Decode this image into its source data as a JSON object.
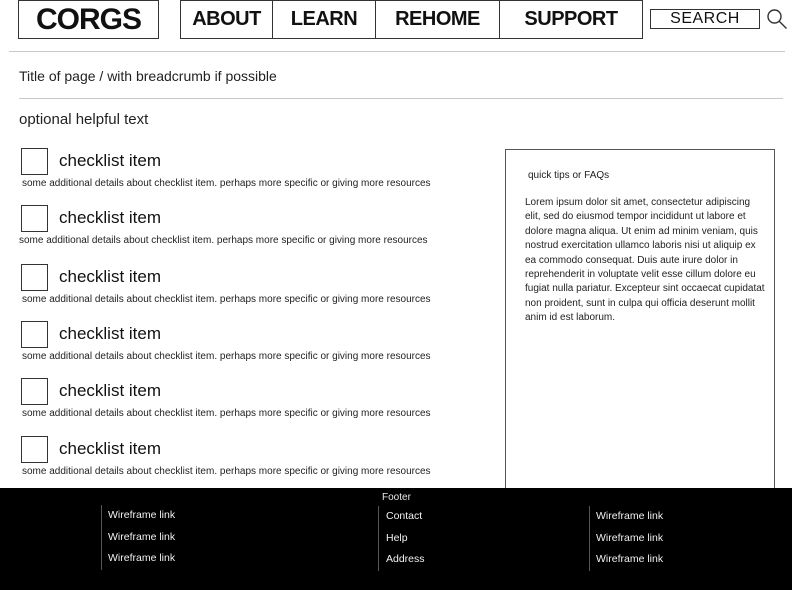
{
  "header": {
    "logo": "CORGS",
    "nav": [
      "ABOUT",
      "LEARN",
      "REHOME",
      "SUPPORT"
    ],
    "search_label": "SEARCH"
  },
  "page": {
    "title": "Title of page  / with breadcrumb if possible",
    "helper_text": "optional helpful text"
  },
  "checklist": [
    {
      "title": "checklist item",
      "detail": "some additional details about checklist item. perhaps more specific or giving more resources"
    },
    {
      "title": "checklist item",
      "detail": "some additional details about checklist item. perhaps more specific or giving more resources"
    },
    {
      "title": "checklist item",
      "detail": "some additional details about checklist item. perhaps more specific or giving more resources"
    },
    {
      "title": "checklist item",
      "detail": "some additional details about checklist item. perhaps more specific or giving more resources"
    },
    {
      "title": "checklist item",
      "detail": "some additional details about checklist item. perhaps more specific or giving more resources"
    },
    {
      "title": "checklist item",
      "detail": "some additional details about checklist item. perhaps more specific or giving more resources"
    }
  ],
  "tips": {
    "title": "quick tips or FAQs",
    "body": "Lorem ipsum dolor sit amet, consectetur adipiscing elit, sed do eiusmod tempor incididunt ut labore et dolore magna aliqua. Ut enim ad minim veniam, quis nostrud exercitation ullamco laboris nisi ut aliquip ex ea commodo consequat. Duis aute irure dolor in reprehenderit in voluptate velit esse cillum dolore eu fugiat nulla pariatur. Excepteur sint occaecat cupidatat non proident, sunt in culpa qui officia deserunt mollit anim id est laborum."
  },
  "footer": {
    "title": "Footer",
    "col1": [
      "Wireframe link",
      "Wireframe link",
      "Wireframe link"
    ],
    "col2": [
      "Contact",
      "Help",
      "Address"
    ],
    "col3": [
      "Wireframe link",
      "Wireframe link",
      "Wireframe link"
    ]
  }
}
